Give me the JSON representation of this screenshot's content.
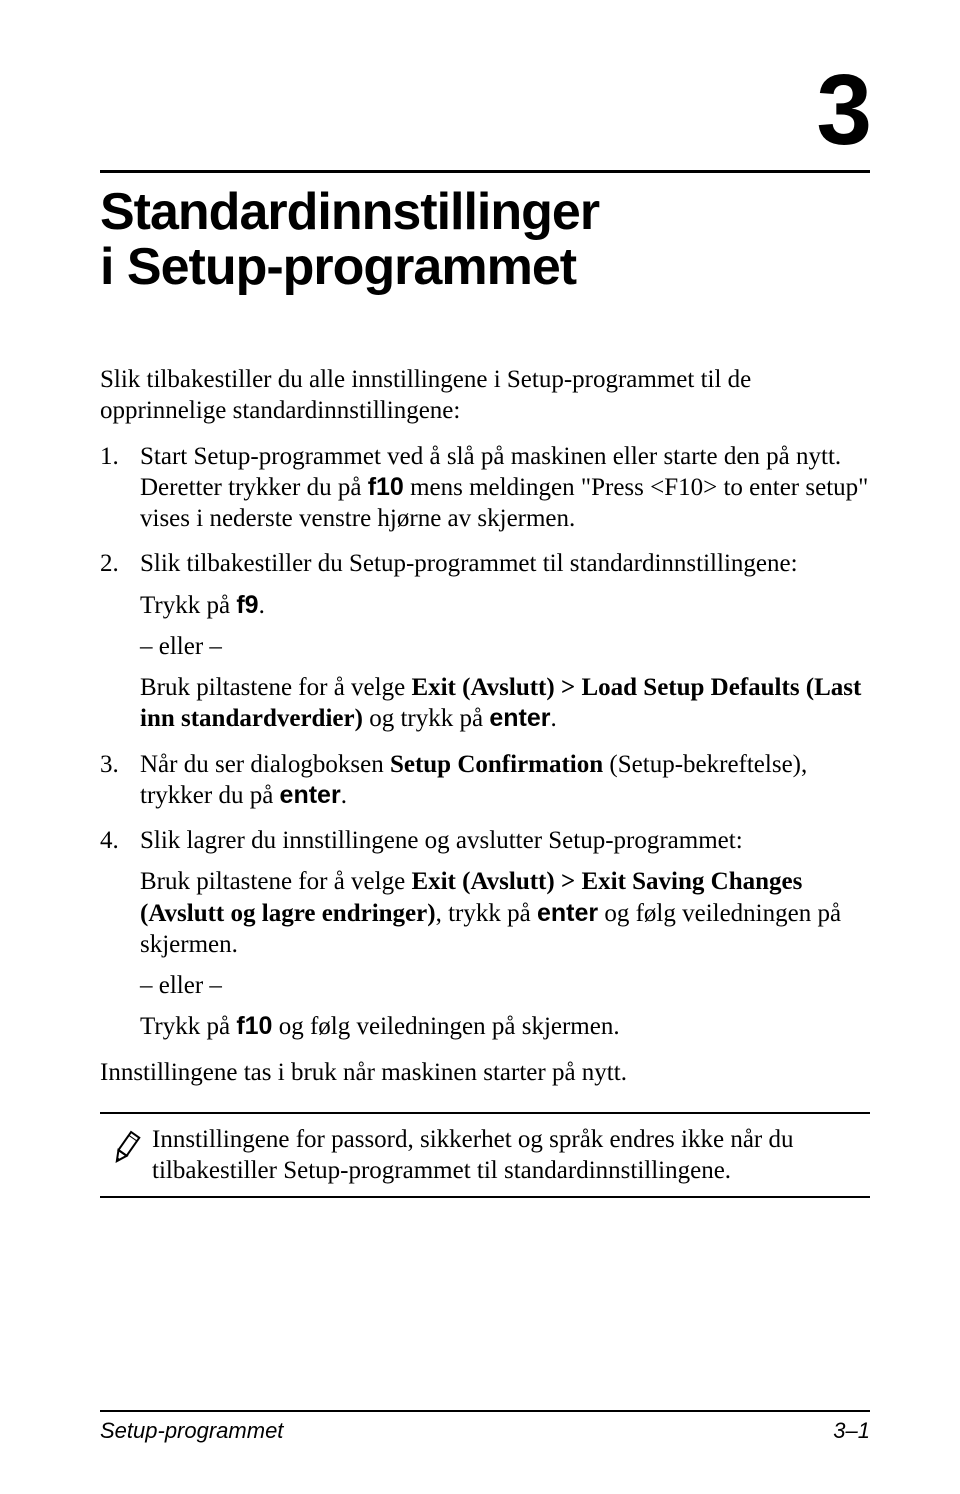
{
  "chapter": {
    "number": "3",
    "title_line1": "Standardinnstillinger",
    "title_line2": "i Setup-programmet"
  },
  "intro": "Slik tilbakestiller du alle innstillingene i Setup-programmet til de opprinnelige standardinnstillingene:",
  "steps": {
    "s1": {
      "a": "Start Setup-programmet ved å slå på maskinen eller starte den på nytt. Deretter trykker du på ",
      "key": "f10",
      "b": " mens meldingen \"Press <F10> to enter setup\" vises i nederste venstre hjørne av skjermen."
    },
    "s2": {
      "intro": "Slik tilbakestiller du Setup-programmet til standardinnstillingene:",
      "line1a": "Trykk på ",
      "line1key": "f9",
      "line1b": ".",
      "or": "– eller –",
      "line2a": "Bruk piltastene for å velge ",
      "line2bold": "Exit (Avslutt) > Load Setup Defaults (Last inn standardverdier)",
      "line2b": " og trykk på ",
      "line2key": "enter",
      "line2c": "."
    },
    "s3": {
      "a": "Når du ser dialogboksen ",
      "bold": "Setup Confirmation",
      "b": " (Setup-bekreftelse), trykker du på ",
      "key": "enter",
      "c": "."
    },
    "s4": {
      "intro": "Slik lagrer du innstillingene og avslutter Setup-programmet:",
      "line1a": "Bruk piltastene for å velge ",
      "line1bold": "Exit (Avslutt) > Exit Saving Changes (Avslutt og lagre endringer)",
      "line1b": ", trykk på ",
      "line1key": "enter",
      "line1c": " og følg veiledningen på skjermen.",
      "or": "– eller –",
      "line2a": "Trykk på ",
      "line2key": "f10",
      "line2b": " og følg veiledningen på skjermen."
    }
  },
  "closing": "Innstillingene tas i bruk når maskinen starter på nytt.",
  "note": "Innstillingene for passord, sikkerhet og språk endres ikke når du tilbakestiller Setup-programmet til standardinnstillingene.",
  "footer": {
    "left": "Setup-programmet",
    "right": "3–1"
  }
}
